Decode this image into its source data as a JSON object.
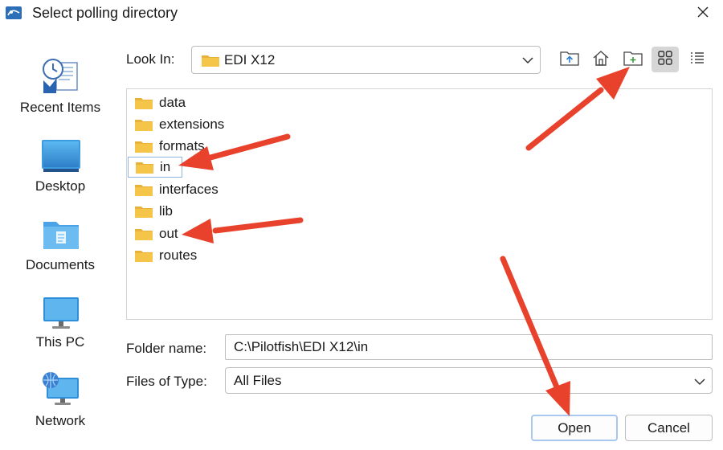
{
  "window": {
    "title": "Select polling directory",
    "app_icon": "app-logo-icon",
    "close_icon": "close-icon"
  },
  "places": [
    {
      "label": "Recent Items",
      "icon": "recent-items-icon"
    },
    {
      "label": "Desktop",
      "icon": "desktop-icon"
    },
    {
      "label": "Documents",
      "icon": "documents-folder-icon"
    },
    {
      "label": "This PC",
      "icon": "computer-monitor-icon"
    },
    {
      "label": "Network",
      "icon": "network-globe-icon"
    }
  ],
  "toolbar": {
    "look_in_label": "Look In:",
    "look_in_value": "EDI X12",
    "buttons": [
      {
        "icon": "up-one-level-icon"
      },
      {
        "icon": "home-icon"
      },
      {
        "icon": "new-folder-icon"
      },
      {
        "icon": "list-grid-view-icon",
        "active": true
      },
      {
        "icon": "details-view-icon"
      }
    ]
  },
  "files": {
    "items": [
      "data",
      "extensions",
      "formats",
      "in",
      "interfaces",
      "lib",
      "out",
      "routes"
    ],
    "selected": "in"
  },
  "form": {
    "folder_name_label": "Folder name:",
    "folder_name_value": "C:\\Pilotfish\\EDI X12\\in",
    "files_of_type_label": "Files of Type:",
    "files_of_type_value": "All Files"
  },
  "buttons": {
    "open": "Open",
    "cancel": "Cancel"
  },
  "colors": {
    "folder": "#f5c54a",
    "accent_border": "#a8c8ef",
    "annotation_arrow": "#e8422c",
    "view_button_active": "#d6d6d6"
  }
}
